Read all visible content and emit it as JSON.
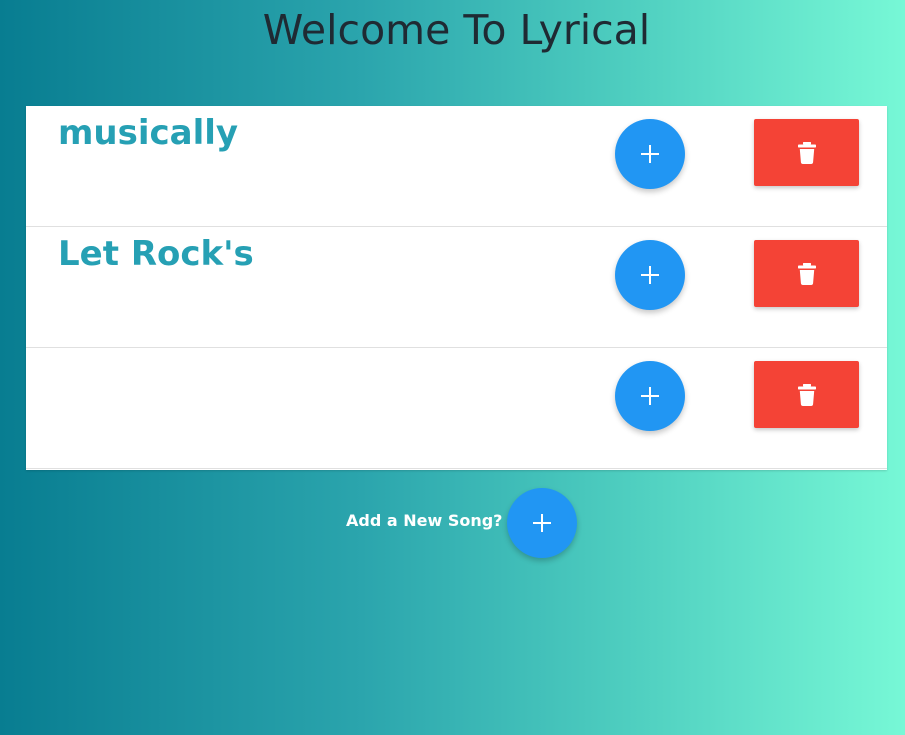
{
  "header": {
    "title": "Welcome To Lyrical"
  },
  "songs": [
    {
      "title": "musically"
    },
    {
      "title": "Let Rock's"
    },
    {
      "title": ""
    }
  ],
  "row_actions": {
    "add_icon": "plus-icon",
    "delete_icon": "trash-icon"
  },
  "footer": {
    "add_song_label": "Add a New Song?",
    "add_icon": "plus-icon"
  },
  "colors": {
    "primary_fab": "#2196f3",
    "delete": "#f44336",
    "song_title": "#26a0b4",
    "gradient_start": "#087d91",
    "gradient_end": "#77f8d6"
  }
}
